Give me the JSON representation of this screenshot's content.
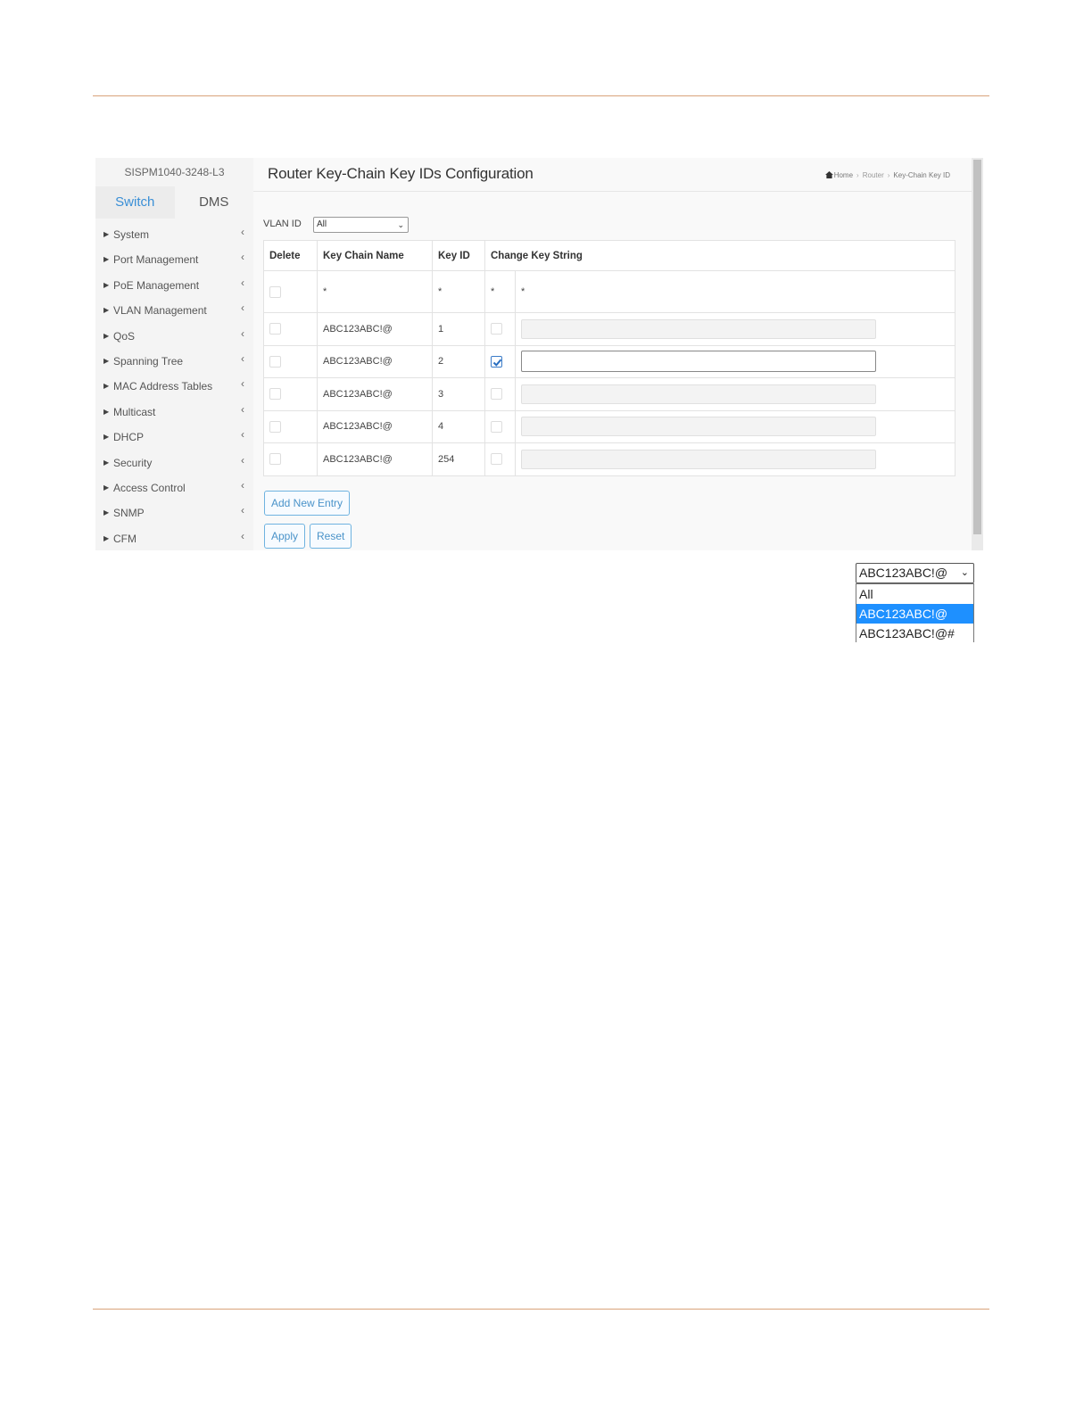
{
  "sidebar": {
    "device_name": "SISPM1040-3248-L3",
    "tabs": [
      {
        "label": "Switch",
        "active": true
      },
      {
        "label": "DMS",
        "active": false
      }
    ],
    "menu": [
      {
        "label": "System"
      },
      {
        "label": "Port Management"
      },
      {
        "label": "PoE Management"
      },
      {
        "label": "VLAN Management"
      },
      {
        "label": "QoS"
      },
      {
        "label": "Spanning Tree"
      },
      {
        "label": "MAC Address Tables"
      },
      {
        "label": "Multicast"
      },
      {
        "label": "DHCP"
      },
      {
        "label": "Security"
      },
      {
        "label": "Access Control"
      },
      {
        "label": "SNMP"
      },
      {
        "label": "CFM"
      }
    ]
  },
  "header": {
    "title": "Router Key-Chain Key IDs Configuration",
    "breadcrumb": {
      "home": "Home",
      "section": "Router",
      "page": "Key-Chain Key ID"
    }
  },
  "filter": {
    "label": "VLAN ID",
    "value": "All"
  },
  "table": {
    "columns": [
      "Delete",
      "Key Chain Name",
      "Key ID",
      "Change Key String"
    ],
    "wildcard": {
      "name": "*",
      "key_id": "*",
      "change": "*",
      "string": "*"
    },
    "rows": [
      {
        "name": "ABC123ABC!@",
        "key_id": "1",
        "change_checked": false
      },
      {
        "name": "ABC123ABC!@",
        "key_id": "2",
        "change_checked": true
      },
      {
        "name": "ABC123ABC!@",
        "key_id": "3",
        "change_checked": false
      },
      {
        "name": "ABC123ABC!@",
        "key_id": "4",
        "change_checked": false
      },
      {
        "name": "ABC123ABC!@",
        "key_id": "254",
        "change_checked": false
      }
    ]
  },
  "buttons": {
    "add": "Add New Entry",
    "apply": "Apply",
    "reset": "Reset"
  },
  "dropdown_example": {
    "selected": "ABC123ABC!@",
    "options": [
      "All",
      "ABC123ABC!@",
      "ABC123ABC!@#"
    ],
    "highlighted": "ABC123ABC!@"
  },
  "colors": {
    "accent": "#3a8fd6",
    "rule": "#d9a37a",
    "highlight": "#1e90ff"
  }
}
